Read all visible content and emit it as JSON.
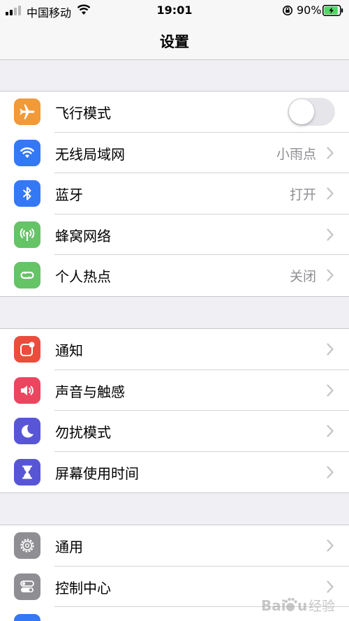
{
  "status_bar": {
    "carrier": "中国移动",
    "time": "19:01",
    "battery_percent": "90%",
    "battery_level": 0.9
  },
  "nav": {
    "title": "设置"
  },
  "groups": [
    {
      "items": [
        {
          "label": "飞行模式",
          "icon": "airplane-icon",
          "icon_color": "#f19a37",
          "control": "toggle",
          "toggle_on": false
        },
        {
          "label": "无线局域网",
          "icon": "wifi-icon",
          "icon_color": "#3478f6",
          "value": "小雨点"
        },
        {
          "label": "蓝牙",
          "icon": "bluetooth-icon",
          "icon_color": "#3478f6",
          "value": "打开"
        },
        {
          "label": "蜂窝网络",
          "icon": "antenna-icon",
          "icon_color": "#64c466",
          "value": ""
        },
        {
          "label": "个人热点",
          "icon": "hotspot-icon",
          "icon_color": "#64c466",
          "value": "关闭"
        }
      ]
    },
    {
      "items": [
        {
          "label": "通知",
          "icon": "notification-icon",
          "icon_color": "#eb4d3d"
        },
        {
          "label": "声音与触感",
          "icon": "speaker-icon",
          "icon_color": "#eb4560"
        },
        {
          "label": "勿扰模式",
          "icon": "moon-icon",
          "icon_color": "#5856d6"
        },
        {
          "label": "屏幕使用时间",
          "icon": "hourglass-icon",
          "icon_color": "#5856d6"
        }
      ]
    },
    {
      "items": [
        {
          "label": "通用",
          "icon": "gear-icon",
          "icon_color": "#8e8e93"
        },
        {
          "label": "控制中心",
          "icon": "switches-icon",
          "icon_color": "#8e8e93"
        },
        {
          "label": "",
          "icon": "display-icon",
          "icon_color": "#3478f6"
        }
      ]
    }
  ],
  "watermark": {
    "text": "Baidu 经验"
  }
}
